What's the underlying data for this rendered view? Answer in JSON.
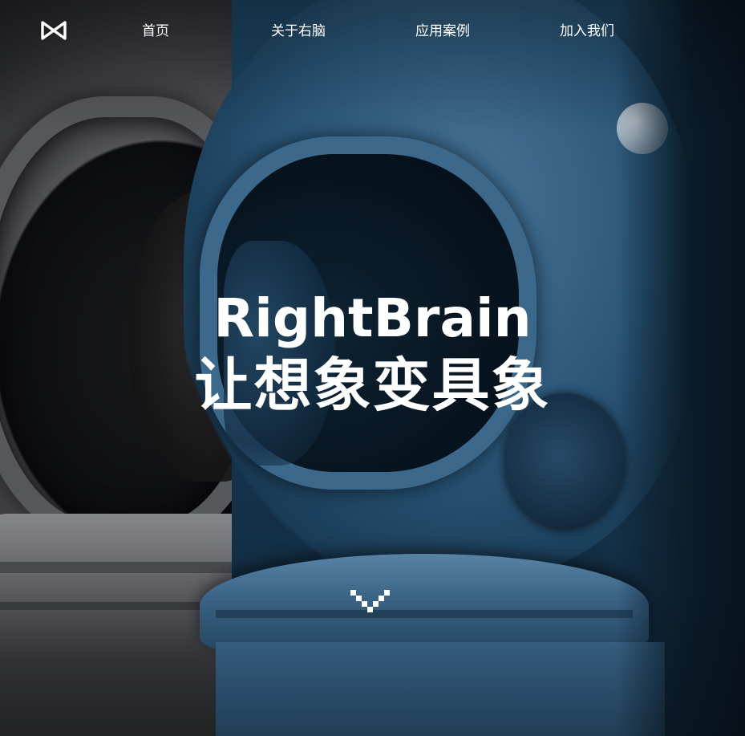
{
  "nav": {
    "logo_icon": "rightbrain-logo-icon",
    "items": [
      {
        "label": "首页"
      },
      {
        "label": "关于右脑"
      },
      {
        "label": "应用案例"
      },
      {
        "label": "加入我们"
      }
    ]
  },
  "hero": {
    "title_en": "RightBrain",
    "title_zh": "让想象变具象",
    "left_tone": "grayscale",
    "right_tone": "#1f4a6a",
    "scroll_icon": "chevron-down-icon"
  }
}
